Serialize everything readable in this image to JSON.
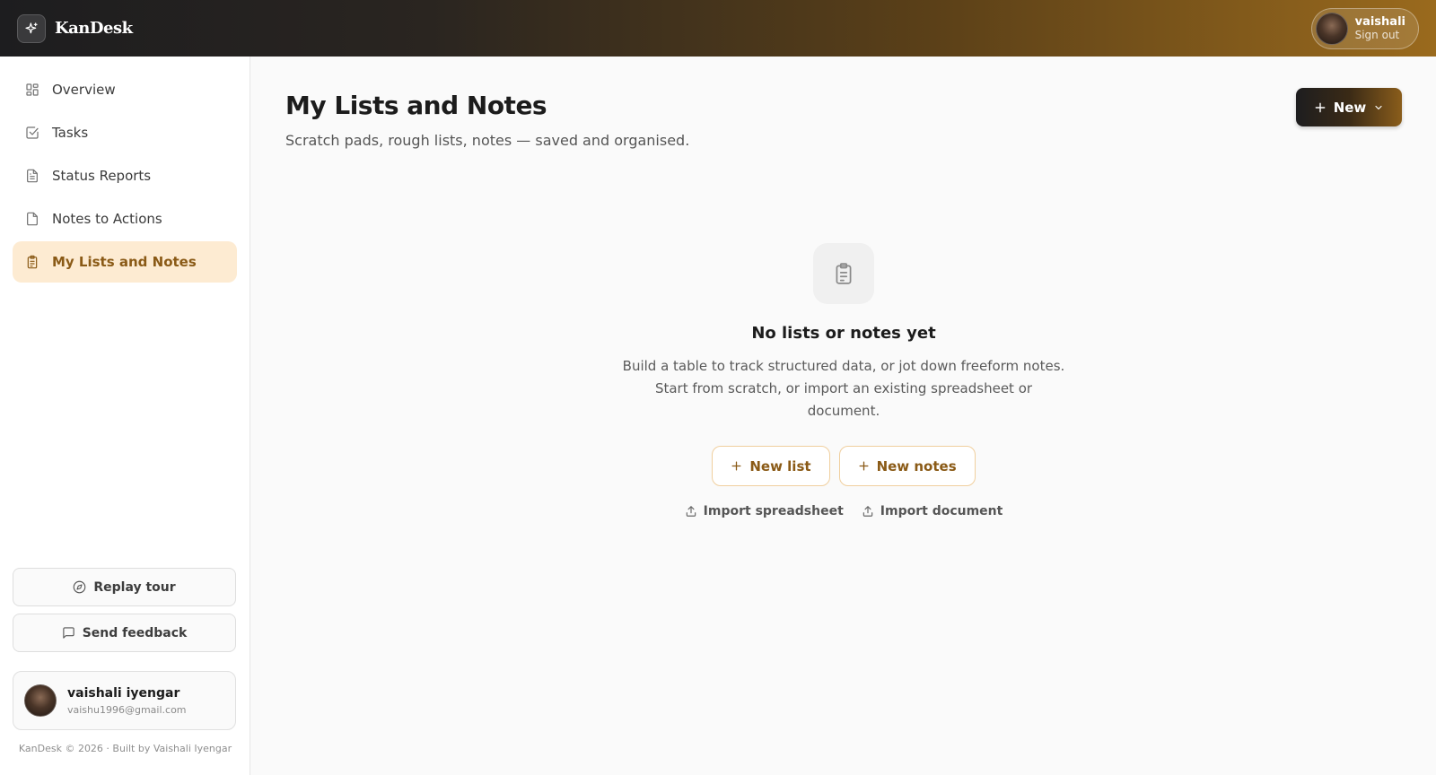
{
  "app": {
    "name": "KanDesk"
  },
  "header_user": {
    "name": "vaishali",
    "action": "Sign out"
  },
  "sidebar": {
    "items": [
      {
        "label": "Overview",
        "icon": "grid-icon",
        "active": false
      },
      {
        "label": "Tasks",
        "icon": "checkbox-icon",
        "active": false
      },
      {
        "label": "Status Reports",
        "icon": "document-icon",
        "active": false
      },
      {
        "label": "Notes to Actions",
        "icon": "page-icon",
        "active": false
      },
      {
        "label": "My Lists and Notes",
        "icon": "clipboard-icon",
        "active": true
      }
    ],
    "replay_tour": "Replay tour",
    "send_feedback": "Send feedback",
    "profile": {
      "name": "vaishali iyengar",
      "email": "vaishu1996@gmail.com"
    },
    "footer": "KanDesk © 2026 · Built by Vaishali Iyengar"
  },
  "main": {
    "title": "My Lists and Notes",
    "subtitle": "Scratch pads, rough lists, notes — saved and organised.",
    "new_button": "New",
    "empty": {
      "title": "No lists or notes yet",
      "description": "Build a table to track structured data, or jot down freeform notes. Start from scratch, or import an existing spreadsheet or document.",
      "new_list": "New list",
      "new_notes": "New notes",
      "import_spreadsheet": "Import spreadsheet",
      "import_document": "Import document"
    }
  },
  "colors": {
    "accent": "#8a5a16",
    "active_bg": "#fdebd2",
    "header_dark": "#1d1d1f",
    "header_gold": "#9a6a1d"
  }
}
